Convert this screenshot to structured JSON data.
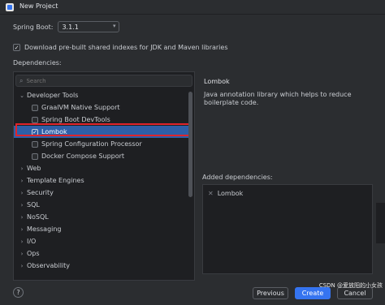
{
  "window": {
    "title": "New Project"
  },
  "spring_boot": {
    "label": "Spring Boot:",
    "value": "3.1.1"
  },
  "download_indexes": {
    "label": "Download pre-built shared indexes for JDK and Maven libraries",
    "checked": true
  },
  "dependencies": {
    "label": "Dependencies:",
    "search_placeholder": "Search",
    "tree": [
      {
        "label": "Developer Tools",
        "expanded": true
      },
      {
        "label": "GraalVM Native Support",
        "checked": false
      },
      {
        "label": "Spring Boot DevTools",
        "checked": false
      },
      {
        "label": "Lombok",
        "checked": true,
        "selected": true
      },
      {
        "label": "Spring Configuration Processor",
        "checked": false
      },
      {
        "label": "Docker Compose Support",
        "checked": false
      },
      {
        "label": "Web"
      },
      {
        "label": "Template Engines"
      },
      {
        "label": "Security"
      },
      {
        "label": "SQL"
      },
      {
        "label": "NoSQL"
      },
      {
        "label": "Messaging"
      },
      {
        "label": "I/O"
      },
      {
        "label": "Ops"
      },
      {
        "label": "Observability"
      }
    ]
  },
  "details": {
    "title": "Lombok",
    "description": "Java annotation library which helps to reduce boilerplate code."
  },
  "added": {
    "label": "Added dependencies:",
    "items": [
      "Lombok"
    ]
  },
  "buttons": {
    "previous": "Previous",
    "create": "Create",
    "cancel": "Cancel",
    "help": "?"
  },
  "watermark": "CSDN @爱放阳的小女孩",
  "colors": {
    "accent": "#3574f0",
    "selection": "#2e5fa8",
    "highlight_border": "#e0242b"
  }
}
